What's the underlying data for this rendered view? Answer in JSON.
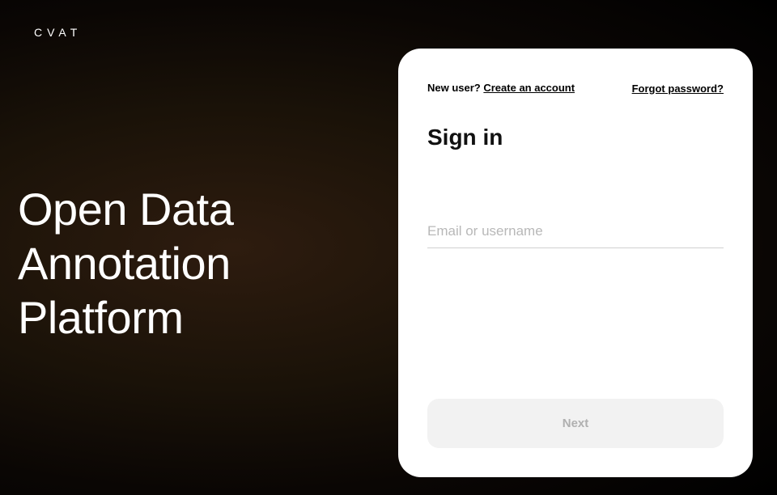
{
  "logo": "CVAT",
  "tagline": {
    "line1": "Open Data",
    "line2": "Annotation",
    "line3": "Platform"
  },
  "signin": {
    "newUserPrefix": "New user? ",
    "createAccountLabel": "Create an account",
    "forgotPasswordLabel": "Forgot password?",
    "title": "Sign in",
    "emailPlaceholder": "Email or username",
    "emailValue": "",
    "nextButtonLabel": "Next"
  }
}
